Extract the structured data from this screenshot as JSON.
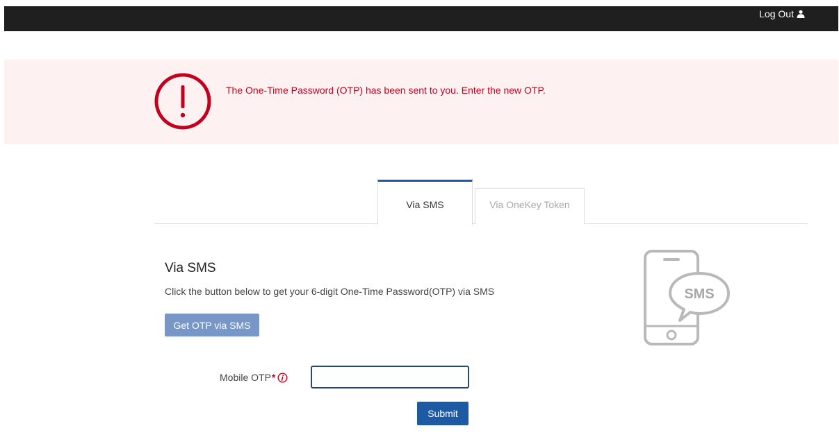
{
  "header": {
    "logout_label": "Log Out",
    "logout_icon": "user-icon"
  },
  "alert": {
    "icon": "exclamation-circle-icon",
    "message": "The One-Time Password (OTP) has been sent to you. Enter the new OTP.",
    "color": "#c3001d",
    "background": "#fdf1f1"
  },
  "tabs": [
    {
      "label": "Via SMS",
      "active": true
    },
    {
      "label": "Via OneKey Token",
      "active": false
    }
  ],
  "sms_section": {
    "title": "Via SMS",
    "description": "Click the button below to get your 6-digit One-Time Password(OTP) via SMS",
    "get_otp_button": "Get OTP via SMS",
    "illustration_text": "SMS",
    "illustration_icon": "phone-sms-icon"
  },
  "form": {
    "otp_label": "Mobile OTP",
    "required_mark": "*",
    "info_icon": "info-icon",
    "otp_value": "",
    "submit_label": "Submit"
  },
  "colors": {
    "primary": "#1e5aa4",
    "primary_disabled": "#7897c6",
    "topbar": "#1f1f1f",
    "error": "#c3001d"
  }
}
